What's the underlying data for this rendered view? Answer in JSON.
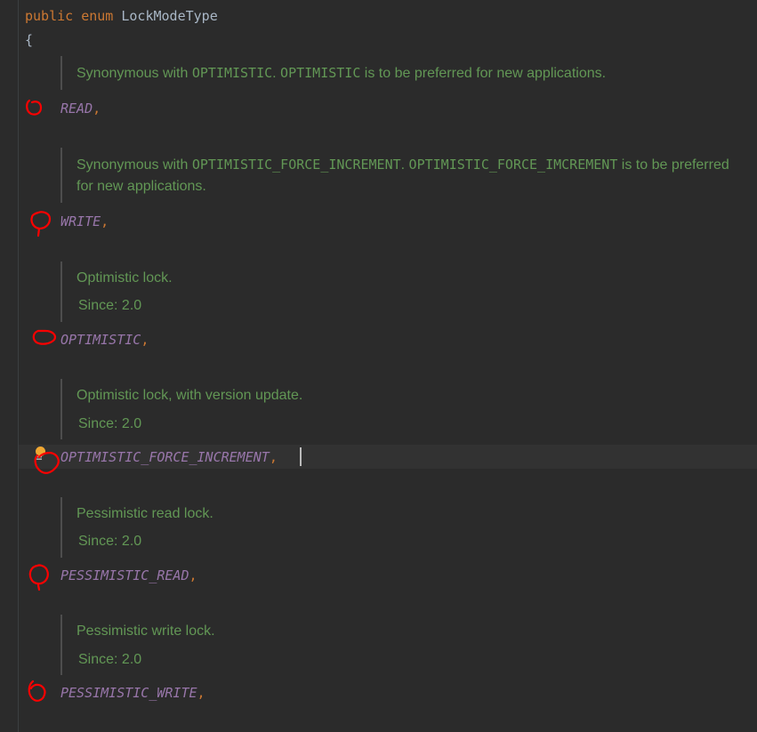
{
  "header": {
    "kw_public": "public",
    "kw_enum": "enum",
    "name": "LockModeType",
    "open_brace": "{"
  },
  "entries": [
    {
      "doc": {
        "t1": "Synonymous with ",
        "c1": "OPTIMISTIC",
        "t2": ". ",
        "c2": "OPTIMISTIC",
        "t3": " is to be preferred for new applications."
      },
      "constant": "READ",
      "sep": ","
    },
    {
      "doc": {
        "t1": "Synonymous with ",
        "c1": "OPTIMISTIC_FORCE_INCREMENT",
        "t2": ". ",
        "c2": "OPTIMISTIC_FORCE_IMCREMENT",
        "t3": " is to be preferred for new applications."
      },
      "constant": "WRITE",
      "sep": ","
    },
    {
      "doc": {
        "text": "Optimistic lock.",
        "since": "Since: 2.0"
      },
      "constant": "OPTIMISTIC",
      "sep": ","
    },
    {
      "doc": {
        "text": "Optimistic lock, with version update.",
        "since": "Since: 2.0"
      },
      "constant": "OPTIMISTIC_FORCE_INCREMENT",
      "sep": ","
    },
    {
      "doc": {
        "text": "Pessimistic read lock.",
        "since": "Since: 2.0"
      },
      "constant": "PESSIMISTIC_READ",
      "sep": ","
    },
    {
      "doc": {
        "text": "Pessimistic write lock.",
        "since": "Since: 2.0"
      },
      "constant": "PESSIMISTIC_WRITE",
      "sep": ","
    }
  ],
  "icons": {
    "intention_bulb": "lightbulb-icon",
    "annotation_marker": "red-circle-annotation"
  },
  "colors": {
    "background": "#2b2b2b",
    "keyword": "#cc7832",
    "identifier": "#a9b7c6",
    "enum_constant": "#9876aa",
    "doc_comment": "#629755",
    "annotation": "#ff0000"
  }
}
